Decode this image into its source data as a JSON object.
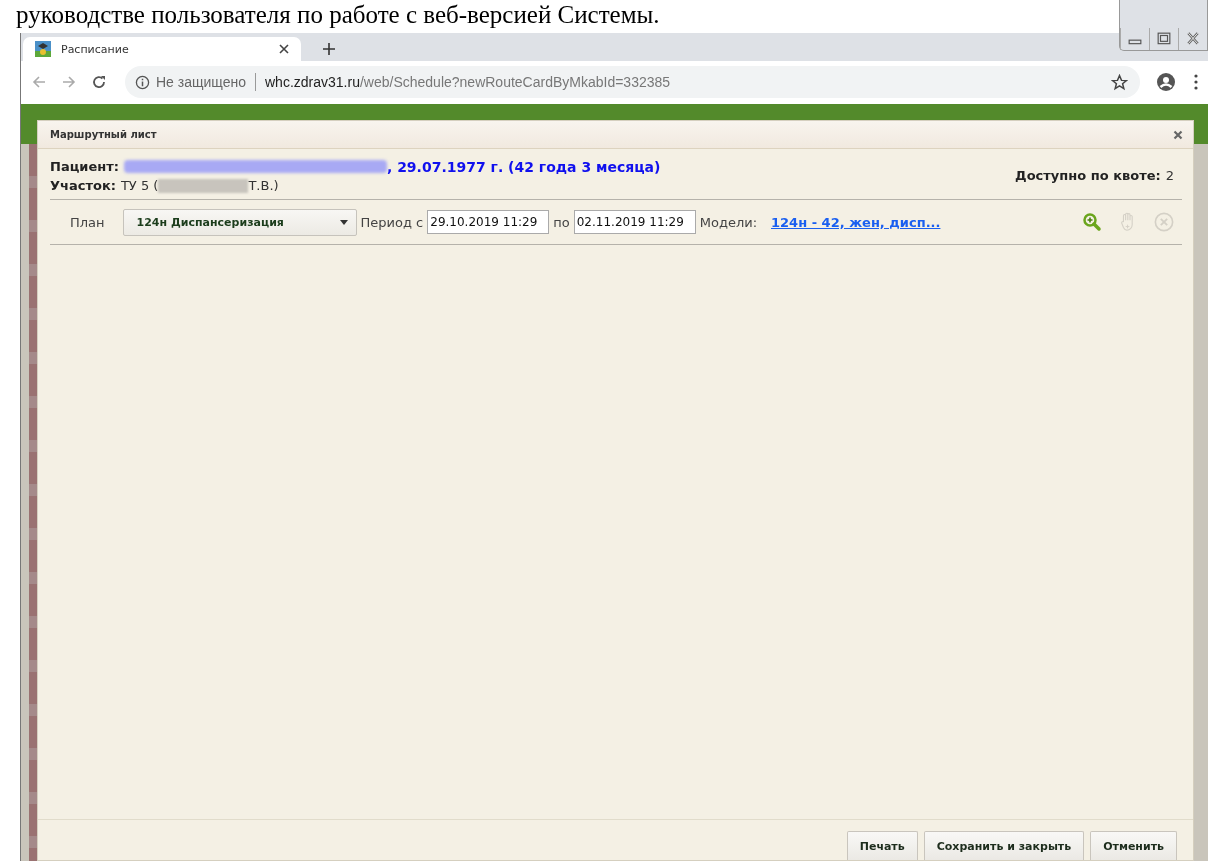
{
  "document_text": "руководстве пользователя по работе с веб-версией Системы.",
  "browser": {
    "tab": {
      "title": "Расписание",
      "selected": true
    },
    "address": {
      "security": "Не защищено",
      "host": "whc.zdrav31.ru",
      "path": "/web/Schedule?newRouteCardByMkabId=332385"
    }
  },
  "dialog": {
    "title": "Маршрутный лист",
    "patient": {
      "label": "Пациент:",
      "details": ", 29.07.1977 г. (42 года 3 месяца)"
    },
    "district": {
      "label": "Участок:",
      "value_start": "ТУ 5 (",
      "value_end": "Т.В.)"
    },
    "quota": {
      "label": "Доступно по квоте:",
      "value": "2"
    },
    "plan": {
      "label": "План",
      "value": "124н Диспансеризация"
    },
    "period": {
      "label": "Период с",
      "from": "29.10.2019 11:29",
      "to_label": "по",
      "to": "02.11.2019 11:29"
    },
    "models": {
      "label": "Модели:",
      "link": "124н - 42, жен, дисп..."
    },
    "tools": [
      {
        "kind": "zoom",
        "disabled": false
      },
      {
        "kind": "hand",
        "disabled": true
      },
      {
        "kind": "cancel",
        "disabled": true
      }
    ],
    "buttons": [
      "Печать",
      "Сохранить и закрыть",
      "Отменить"
    ]
  }
}
